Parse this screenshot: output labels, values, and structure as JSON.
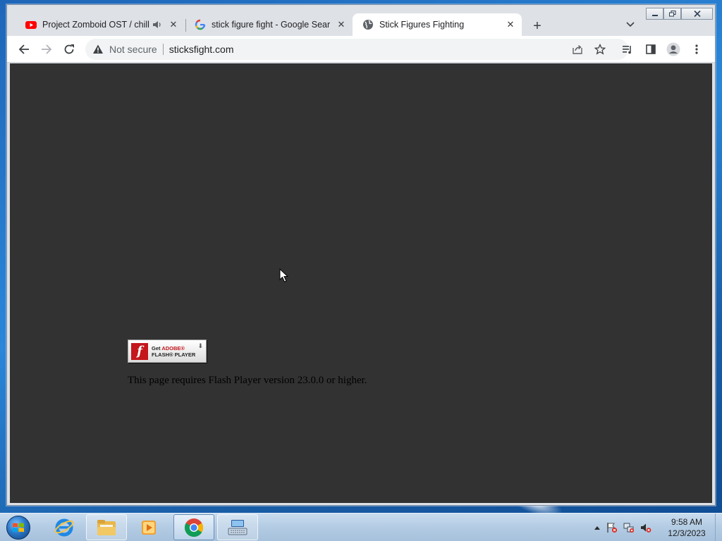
{
  "browser": {
    "tabs": [
      {
        "title": "Project Zomboid OST / chill",
        "favicon": "youtube-icon",
        "audio": true,
        "active": false
      },
      {
        "title": "stick figure fight - Google Search",
        "favicon": "google-icon",
        "audio": false,
        "active": false
      },
      {
        "title": "Stick Figures Fighting",
        "favicon": "globe-icon",
        "audio": false,
        "active": true
      }
    ],
    "address": {
      "security_label": "Not secure",
      "url": "sticksfight.com"
    }
  },
  "page": {
    "flash_badge": {
      "line1_prefix": "Get",
      "line1_brand": "ADOBE®",
      "line2": "FLASH® PLAYER"
    },
    "message": "This page requires Flash Player version 23.0.0 or higher."
  },
  "taskbar": {
    "clock_time": "9:58 AM",
    "clock_date": "12/3/2023"
  },
  "colors": {
    "page_background": "#323232",
    "tabstrip": "#dee1e6",
    "flash_red": "#c4161c"
  }
}
